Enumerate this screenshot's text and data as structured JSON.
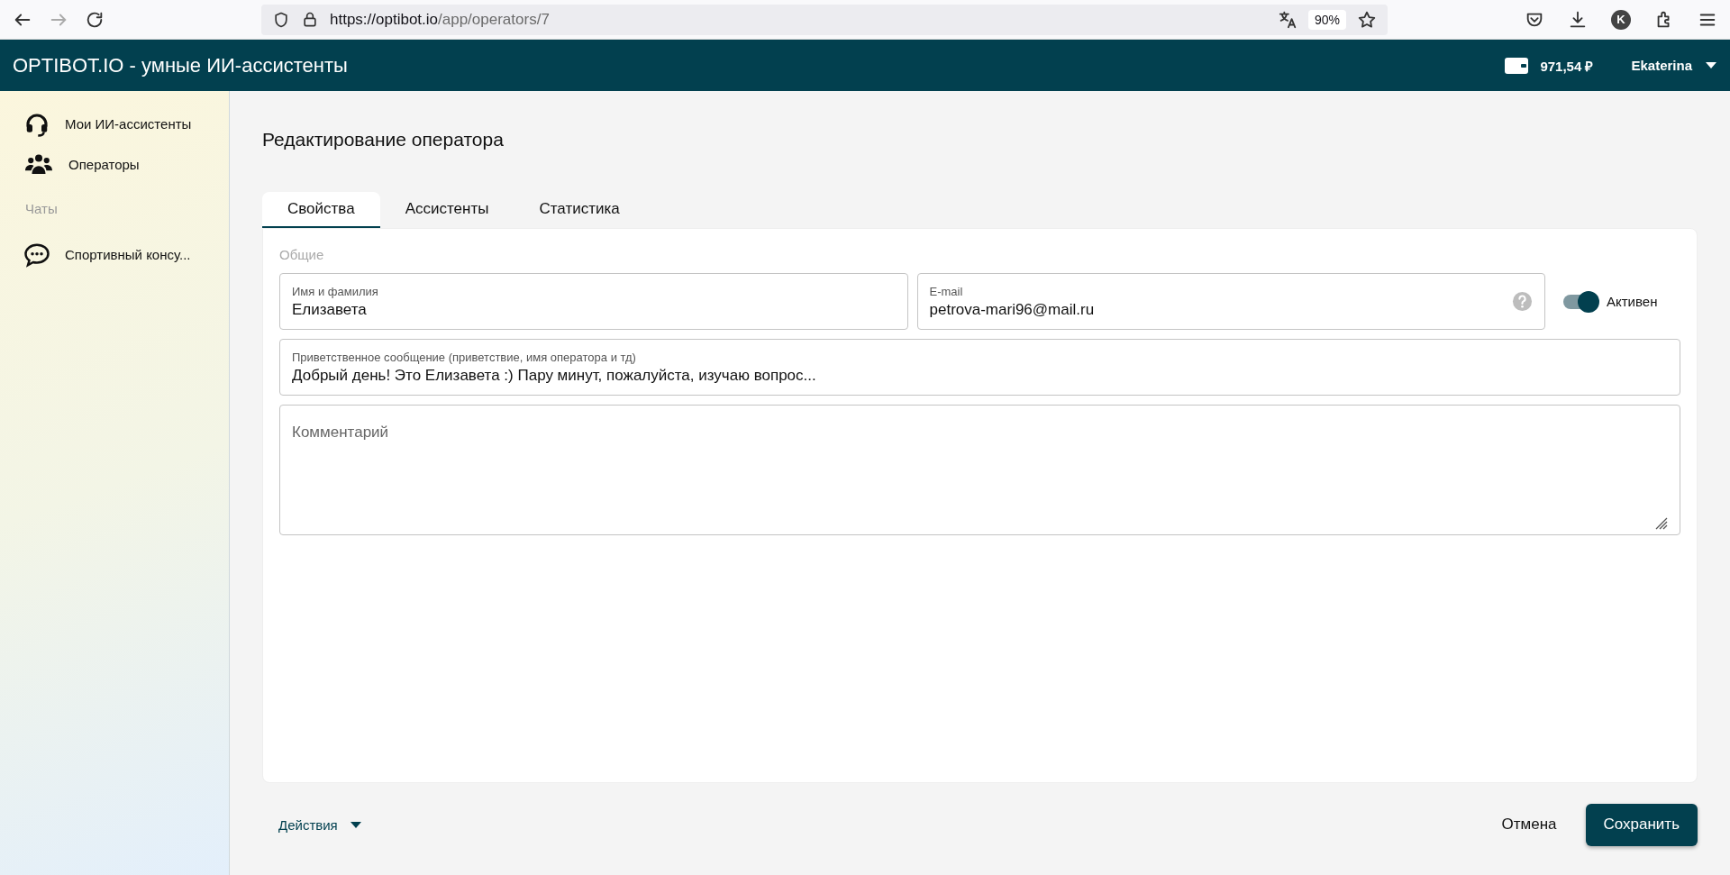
{
  "browser": {
    "url_host": "https://optibot.io",
    "url_path": "/app/operators/7",
    "zoom": "90%",
    "profile_initial": "K"
  },
  "header": {
    "title": "OPTIBOT.IO - умные ИИ-ассистенты",
    "balance": "971,54 ₽",
    "user": "Ekaterina"
  },
  "sidebar": {
    "items": [
      {
        "kind": "headset",
        "label": "Мои ИИ-ассистенты"
      },
      {
        "kind": "people",
        "label": "Операторы"
      }
    ],
    "section": "Чаты",
    "chats": [
      {
        "label": "Спортивный консу..."
      }
    ]
  },
  "page_title": "Редактирование оператора",
  "tabs": [
    {
      "label": "Свойства",
      "selected": true
    },
    {
      "label": "Ассистенты",
      "selected": false
    },
    {
      "label": "Статистика",
      "selected": false
    }
  ],
  "form": {
    "section": "Общие",
    "name": {
      "label": "Имя и фамилия",
      "value": "Елизавета"
    },
    "email": {
      "label": "E-mail",
      "value": "petrova-mari96@mail.ru",
      "help": true
    },
    "toggle": {
      "label": "Активен",
      "on": true
    },
    "greeting": {
      "label": "Приветственное сообщение (приветствие, имя оператора и тд)",
      "value": "Добрый день! Это Елизавета :) Пару минут, пожалуйста, изучаю вопрос..."
    },
    "comment": {
      "placeholder": "Комментарий"
    }
  },
  "footer": {
    "actions": "Действия",
    "cancel": "Отмена",
    "save": "Сохранить"
  }
}
